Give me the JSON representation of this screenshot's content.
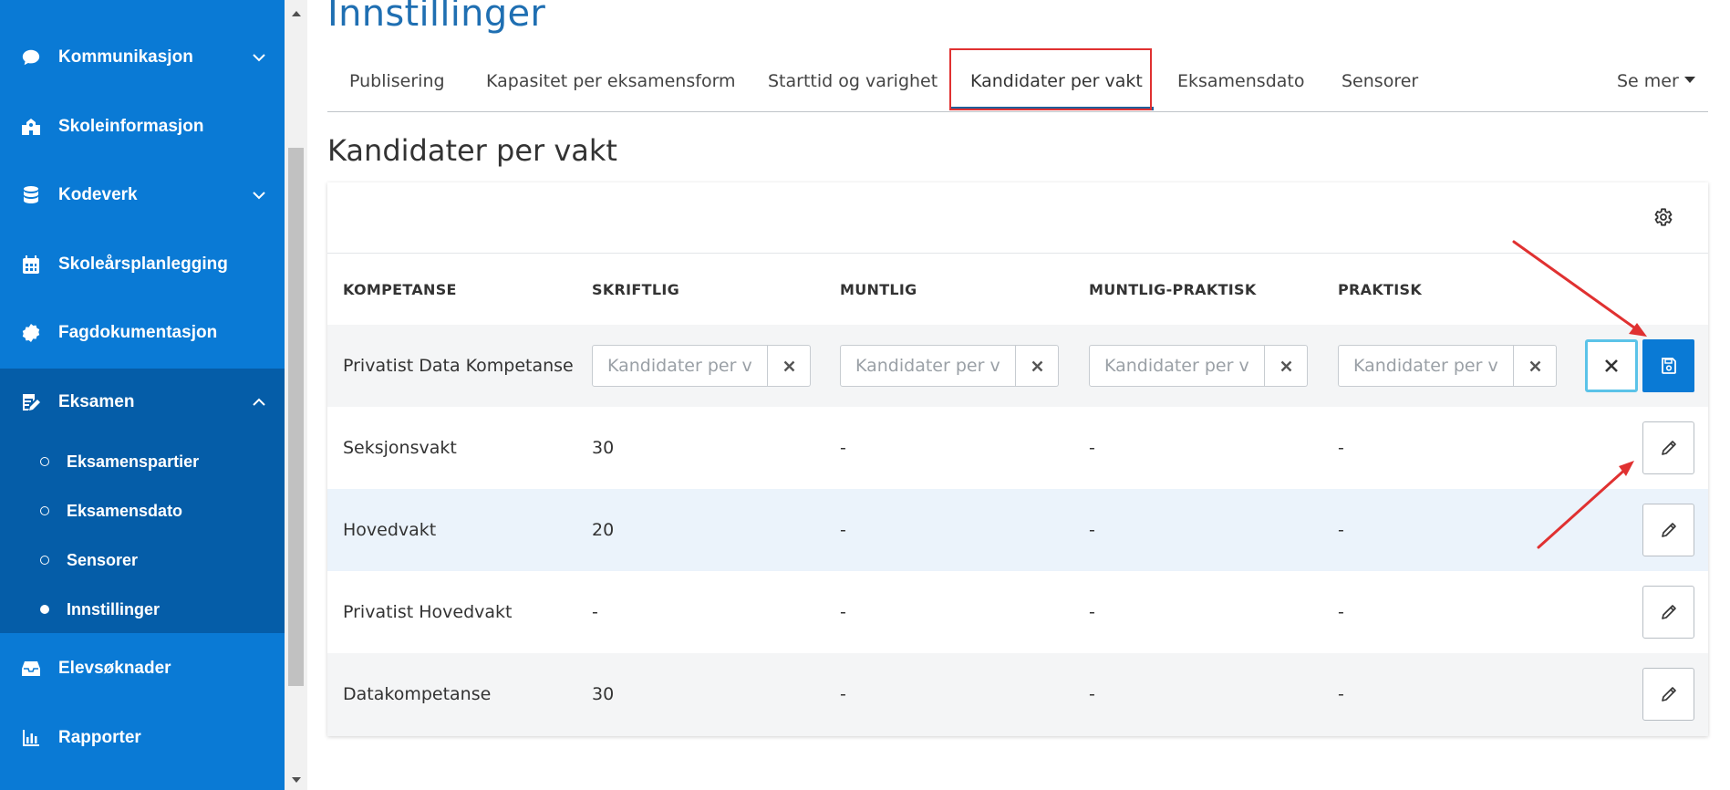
{
  "sidebar": {
    "items": [
      {
        "label": "Kommunikasjon",
        "icon": "chat-bubble-icon",
        "has_chevron": "down"
      },
      {
        "label": "Skoleinformasjon",
        "icon": "school-icon"
      },
      {
        "label": "Kodeverk",
        "icon": "database-icon",
        "has_chevron": "down"
      },
      {
        "label": "Skoleårsplanlegging",
        "icon": "calendar-icon"
      },
      {
        "label": "Fagdokumentasjon",
        "icon": "badge-icon"
      },
      {
        "label": "Eksamen",
        "icon": "edit-document-icon",
        "has_chevron": "up"
      },
      {
        "label": "Elevsøknader",
        "icon": "inbox-icon"
      },
      {
        "label": "Rapporter",
        "icon": "bar-chart-icon"
      }
    ],
    "exam_sub_items": [
      {
        "label": "Eksamenspartier",
        "active": false
      },
      {
        "label": "Eksamensdato",
        "active": false
      },
      {
        "label": "Sensorer",
        "active": false
      },
      {
        "label": "Innstillinger",
        "active": true
      }
    ]
  },
  "page": {
    "title": "Innstillinger",
    "section_title": "Kandidater per vakt"
  },
  "tabs": [
    {
      "label": "Publisering"
    },
    {
      "label": "Kapasitet per eksamensform"
    },
    {
      "label": "Starttid og varighet"
    },
    {
      "label": "Kandidater per vakt",
      "active": true
    },
    {
      "label": "Eksamensdato"
    },
    {
      "label": "Sensorer"
    }
  ],
  "tabs_more": "Se mer",
  "table": {
    "columns": [
      "KOMPETANSE",
      "SKRIFTLIG",
      "MUNTLIG",
      "MUNTLIG-PRAKTISK",
      "PRAKTISK"
    ],
    "edit_row": {
      "name": "Privatist Data Kompetanse",
      "placeholders": [
        "Kandidater per vakt",
        "Kandidater per vakt",
        "Kandidater per vakt",
        "Kandidater per vakt"
      ]
    },
    "rows": [
      {
        "name": "Seksjonsvakt",
        "values": [
          "30",
          "-",
          "-",
          "-"
        ]
      },
      {
        "name": "Hovedvakt",
        "values": [
          "20",
          "-",
          "-",
          "-"
        ]
      },
      {
        "name": "Privatist Hovedvakt",
        "values": [
          "-",
          "-",
          "-",
          "-"
        ]
      },
      {
        "name": "Datakompetanse",
        "values": [
          "30",
          "-",
          "-",
          "-"
        ]
      }
    ]
  },
  "colors": {
    "sidebar_bg": "#0a7ad5",
    "sidebar_active_bg": "#055da8",
    "title_color": "#1f6fb2",
    "annotation_red": "#e03131",
    "focus_ring": "#5bc3e8"
  }
}
